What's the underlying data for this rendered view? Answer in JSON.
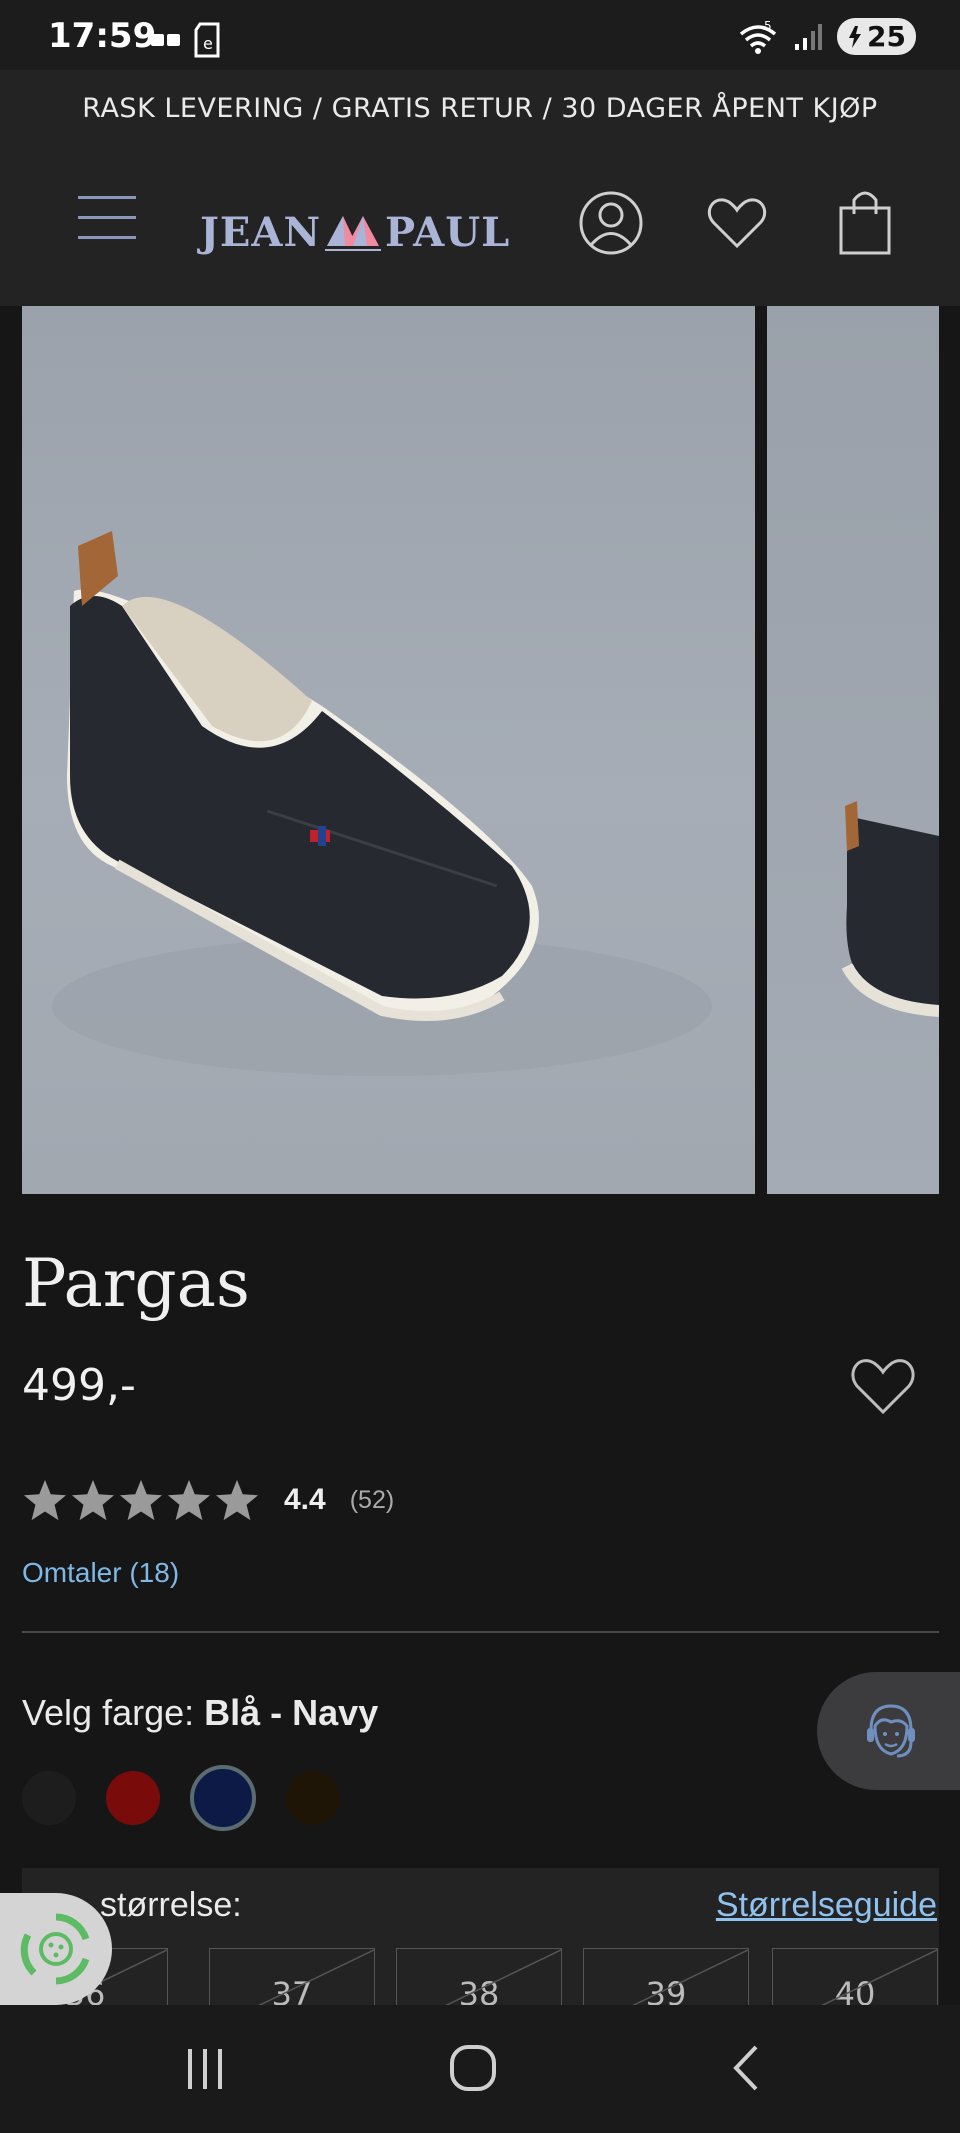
{
  "status": {
    "time": "17:59",
    "battery": "25",
    "network": "5",
    "notification_icon_text": "e"
  },
  "promo_bar": {
    "text": "RASK LEVERING / GRATIS RETUR / 30 DAGER ÅPENT KJØP"
  },
  "header": {
    "brand_left": "JEAN",
    "brand_right": "PAUL",
    "icons": [
      "menu-icon",
      "account-icon",
      "wishlist-icon",
      "cart-icon"
    ]
  },
  "product": {
    "title": "Pargas",
    "price": "499,-",
    "rating": {
      "score": "4.4",
      "count": "(52)",
      "stars": 5
    },
    "reviews_link": "Omtaler (18)",
    "color": {
      "label": "Velg farge:",
      "selected": "Blå - Navy",
      "swatches": [
        {
          "name": "black",
          "hex": "#1d1d1d",
          "selected": false
        },
        {
          "name": "red",
          "hex": "#7a0b0b",
          "selected": false
        },
        {
          "name": "navy",
          "hex": "#0c1a45",
          "selected": true
        },
        {
          "name": "brown",
          "hex": "#1e1507",
          "selected": false
        }
      ]
    },
    "size": {
      "label": "størrelse:",
      "guide_link": "Størrelseguide",
      "options": [
        "36",
        "37",
        "38",
        "39",
        "40"
      ]
    }
  },
  "colors": {
    "background": "#161617",
    "header_bg": "#232324",
    "link": "#7fb7e6",
    "logo": "#aab4d6"
  }
}
